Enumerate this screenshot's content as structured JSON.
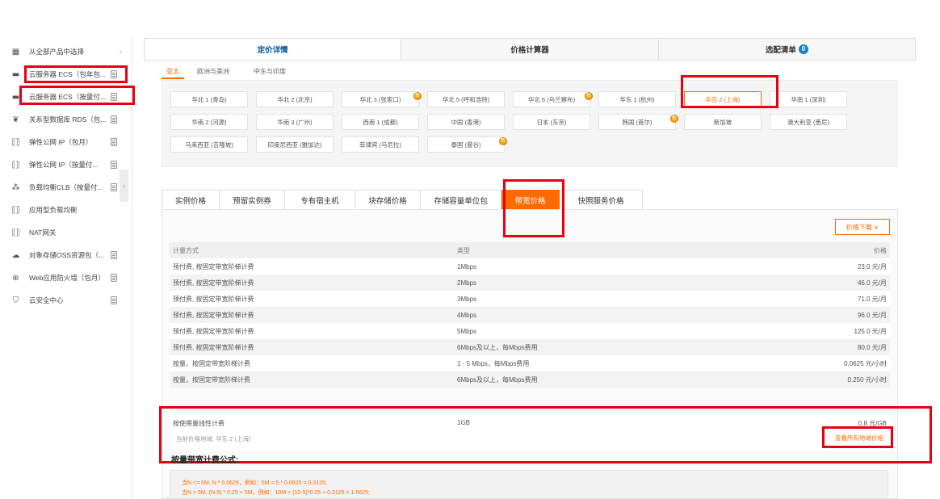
{
  "sidebar": {
    "items": [
      {
        "icon": "grid-icon",
        "glyph": "▦",
        "label": "从全部产品中选择",
        "trail": "chevron"
      },
      {
        "icon": "server-icon",
        "glyph": "▬",
        "label": "云服务器 ECS（包年包...",
        "trail": "doc"
      },
      {
        "icon": "server-icon",
        "glyph": "▬",
        "label": "云服务器 ECS（按量付...",
        "trail": "doc"
      },
      {
        "icon": "database-icon",
        "glyph": "❦",
        "label": "关系型数据库 RDS（包...",
        "trail": "doc"
      },
      {
        "icon": "eip-icon",
        "glyph": "⟦⟧",
        "label": "弹性公网 IP（包月）",
        "trail": "doc"
      },
      {
        "icon": "eip-icon",
        "glyph": "⟦⟧",
        "label": "弹性公网 IP（按量付...",
        "trail": "doc"
      },
      {
        "icon": "load-balancer-icon",
        "glyph": "⁂",
        "label": "负载均衡CLB（按量付...",
        "trail": "doc"
      },
      {
        "icon": "alb-icon",
        "glyph": "⟦⟧",
        "label": "应用型负载均衡",
        "trail": "none"
      },
      {
        "icon": "nat-icon",
        "glyph": "⟦⟧",
        "label": "NAT网关",
        "trail": "none"
      },
      {
        "icon": "cloud-icon",
        "glyph": "☁",
        "label": "对象存储OSS资源包（...",
        "trail": "doc"
      },
      {
        "icon": "firewall-icon",
        "glyph": "⊕",
        "label": "Web应用防火墙（包月）",
        "trail": "doc"
      },
      {
        "icon": "shield-icon",
        "glyph": "⛉",
        "label": "云安全中心",
        "trail": "doc"
      }
    ],
    "collapse_glyph": "‹"
  },
  "top_tabs": [
    {
      "label": "定价详情",
      "active": true
    },
    {
      "label": "价格计算器",
      "active": false
    },
    {
      "label": "选配清单",
      "active": false,
      "badge": "0"
    }
  ],
  "region_tabs": [
    {
      "label": "亚太",
      "active": true
    },
    {
      "label": "欧洲与美洲",
      "active": false
    },
    {
      "label": "中东与印度",
      "active": false
    }
  ],
  "regions": [
    [
      "华北 1 (青岛)",
      "华北 2 (北京)",
      "华北 3 (张家口)",
      "华北 5 (呼和浩特)",
      "华北 6 (乌兰察布)",
      "华东 1 (杭州)",
      "华东 2 (上海)",
      "华南 1 (深圳)"
    ],
    [
      "华南 2 (河源)",
      "华南 3 (广州)",
      "西南 1 (成都)",
      "中国 (香港)",
      "日本 (东京)",
      "韩国 (首尔)",
      "新加坡",
      "澳大利亚 (悉尼)"
    ],
    [
      "马来西亚 (吉隆坡)",
      "印度尼西亚 (雅加达)",
      "菲律宾 (马尼拉)",
      "泰国 (曼谷)"
    ]
  ],
  "selected_region": "华东 2 (上海)",
  "new_badge_glyph": "新",
  "price_tabs": [
    {
      "label": "实例价格",
      "active": false
    },
    {
      "label": "预留实例券",
      "active": false
    },
    {
      "label": "专有宿主机",
      "active": false
    },
    {
      "label": "块存储价格",
      "active": false
    },
    {
      "label": "存储容量单位包",
      "active": false
    },
    {
      "label": "带宽价格",
      "active": true
    },
    {
      "label": "快照服务价格",
      "active": false
    }
  ],
  "download_label": "价格下载 ∨",
  "table": {
    "headers": [
      "计量方式",
      "类型",
      "价格"
    ],
    "rows": [
      [
        "预付费, 按固定带宽阶梯计费",
        "1Mbps",
        "23.0 元/月"
      ],
      [
        "预付费, 按固定带宽阶梯计费",
        "2Mbps",
        "46.0 元/月"
      ],
      [
        "预付费, 按固定带宽阶梯计费",
        "3Mbps",
        "71.0 元/月"
      ],
      [
        "预付费, 按固定带宽阶梯计费",
        "4Mbps",
        "96.0 元/月"
      ],
      [
        "预付费, 按固定带宽阶梯计费",
        "5Mbps",
        "125.0 元/月"
      ],
      [
        "预付费, 按固定带宽阶梯计费",
        "6Mbps及以上，每Mbps费用",
        "80.0 元/月"
      ],
      [
        "按量，按固定带宽阶梯计费",
        "1 - 5 Mbps，每Mbps费用",
        "0.0625 元/小时"
      ],
      [
        "按量，按固定带宽阶梯计费",
        "6Mbps及以上，每Mbps费用",
        "0.250 元/小时"
      ]
    ],
    "last_row": {
      "method": "按使用量线性计费",
      "type": "1GB",
      "price": "0.8 元/GB",
      "current_region": "当前价格地域: 华东 2 (上海)",
      "view_all": "查看所有地域价格"
    }
  },
  "formula": {
    "title": "按量带宽计费公式:",
    "lines": [
      "当N <= 5M, N * 0.0625，例如：5M = 5 * 0.0625 = 0.3125;",
      "当N > 5M, (N-5) * 0.25 + 5M，例如：10M = (10-5)*0.25 + 0.3125 = 1.5625;"
    ]
  },
  "colors": {
    "accent": "#ff6a00",
    "annotation": "#e60012",
    "link": "#00569c"
  }
}
